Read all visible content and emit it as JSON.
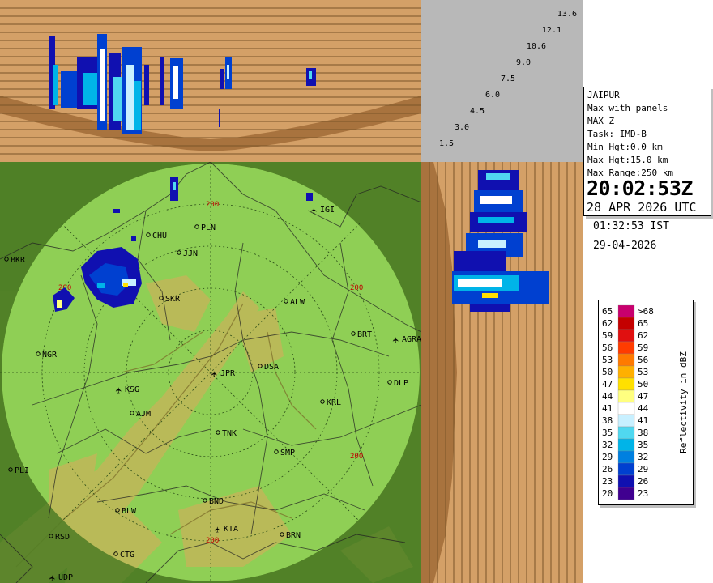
{
  "station": "JAIPUR",
  "product": {
    "mode": "Max with panels",
    "name": "MAX_Z",
    "task": "Task: IMD-B",
    "min_hgt": "Min Hgt:0.0 km",
    "max_hgt": "Max Hgt:15.0 km",
    "max_range": "Max Range:250 km"
  },
  "time": {
    "utc_time": "20:02:53Z",
    "utc_date": "28 APR 2026 UTC",
    "ist_time": "01:32:53 IST",
    "ist_date": "29-04-2026"
  },
  "height_labels": [
    "13.6",
    "12.1",
    "10.6",
    "9.0",
    "7.5",
    "6.0",
    "4.5",
    "3.0",
    "1.5"
  ],
  "range_ring_label": "200",
  "places": [
    {
      "name": "IGI",
      "type": "airport"
    },
    {
      "name": "PLN",
      "type": "city"
    },
    {
      "name": "CHU",
      "type": "city"
    },
    {
      "name": "JJN",
      "type": "city"
    },
    {
      "name": "BKR",
      "type": "city"
    },
    {
      "name": "SKR",
      "type": "city"
    },
    {
      "name": "ALW",
      "type": "city"
    },
    {
      "name": "BRT",
      "type": "city"
    },
    {
      "name": "AGRA",
      "type": "airport"
    },
    {
      "name": "NGR",
      "type": "city"
    },
    {
      "name": "JPR",
      "type": "airport"
    },
    {
      "name": "DSA",
      "type": "city"
    },
    {
      "name": "KSG",
      "type": "airport"
    },
    {
      "name": "DLP",
      "type": "city"
    },
    {
      "name": "AJM",
      "type": "city"
    },
    {
      "name": "KRL",
      "type": "city"
    },
    {
      "name": "TNK",
      "type": "city"
    },
    {
      "name": "SMP",
      "type": "city"
    },
    {
      "name": "PLI",
      "type": "city"
    },
    {
      "name": "BLW",
      "type": "city"
    },
    {
      "name": "BND",
      "type": "city"
    },
    {
      "name": "KTA",
      "type": "airport"
    },
    {
      "name": "RSD",
      "type": "city"
    },
    {
      "name": "BRN",
      "type": "city"
    },
    {
      "name": "CTG",
      "type": "city"
    },
    {
      "name": "UDP",
      "type": "airport"
    }
  ],
  "legend": {
    "title": "Reflectivity in dBZ",
    "rows": [
      {
        "low": "65",
        "high": ">68",
        "color": "#c8006e"
      },
      {
        "low": "62",
        "high": "65",
        "color": "#c40000"
      },
      {
        "low": "59",
        "high": "62",
        "color": "#e01010"
      },
      {
        "low": "56",
        "high": "59",
        "color": "#ff3c00"
      },
      {
        "low": "53",
        "high": "56",
        "color": "#ff7a00"
      },
      {
        "low": "50",
        "high": "53",
        "color": "#ffb000"
      },
      {
        "low": "47",
        "high": "50",
        "color": "#ffe000"
      },
      {
        "low": "44",
        "high": "47",
        "color": "#ffff80"
      },
      {
        "low": "41",
        "high": "44",
        "color": "#ffffff"
      },
      {
        "low": "38",
        "high": "41",
        "color": "#c8f0ff"
      },
      {
        "low": "35",
        "high": "38",
        "color": "#50d8f0"
      },
      {
        "low": "32",
        "high": "35",
        "color": "#00b4e8"
      },
      {
        "low": "29",
        "high": "32",
        "color": "#0080e0"
      },
      {
        "low": "26",
        "high": "29",
        "color": "#0040d0"
      },
      {
        "low": "23",
        "high": "26",
        "color": "#1010b0"
      },
      {
        "low": "20",
        "high": "23",
        "color": "#400090"
      }
    ]
  },
  "colors": {
    "panel_bg": "#d4a067",
    "panel_dark": "#8b5a2b",
    "grid_line": "#6e4a22",
    "corner_bg": "#b8b8b8",
    "map_land": "#5e8e2e",
    "range_disc": "#8fcf55",
    "terrain": "#c8b45a"
  }
}
